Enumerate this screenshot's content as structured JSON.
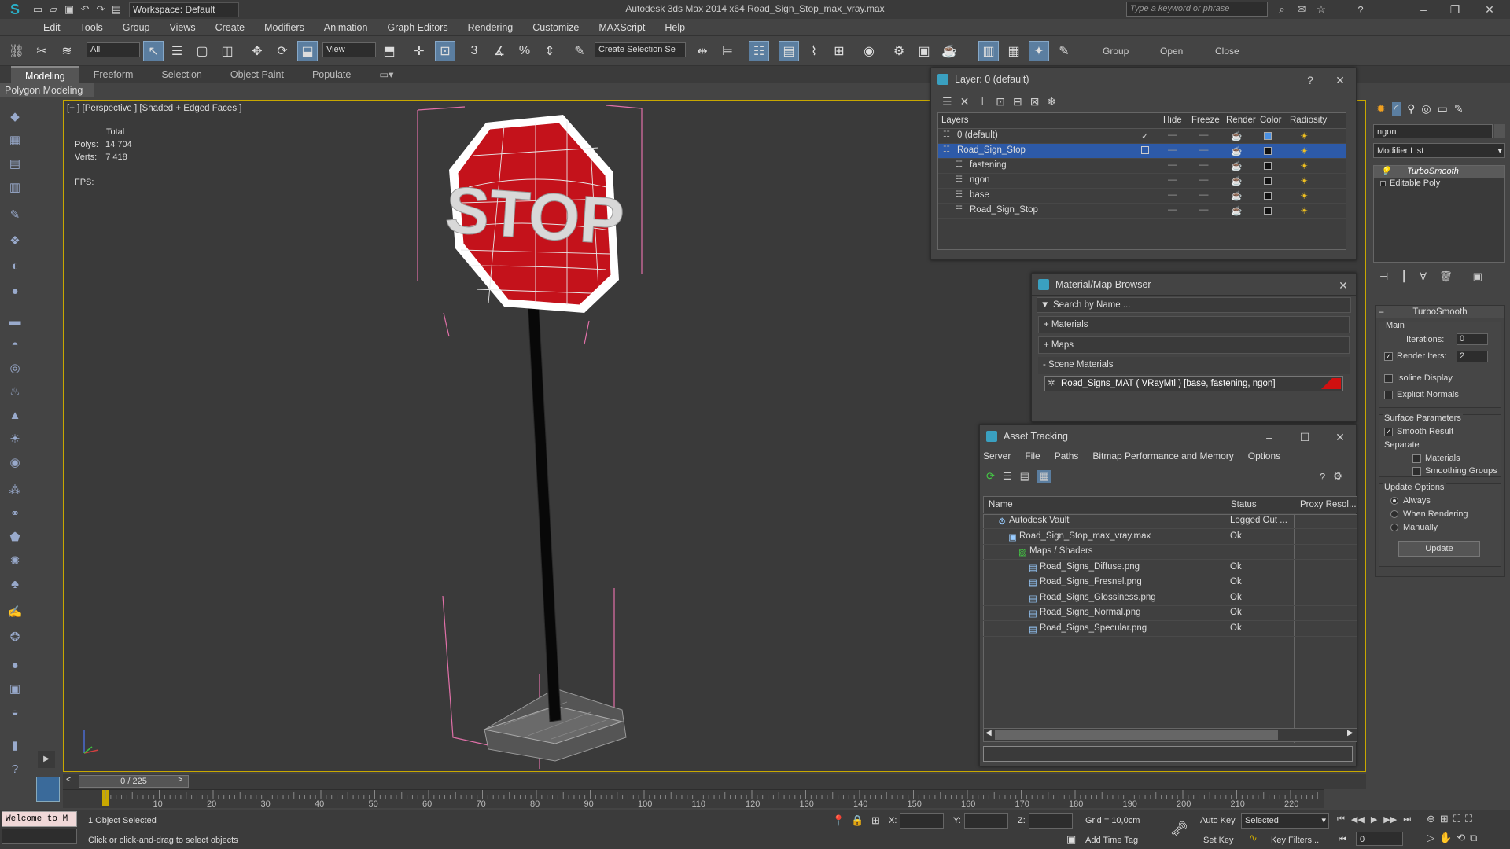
{
  "app": {
    "window_title": "Autodesk 3ds Max  2014 x64      Road_Sign_Stop_max_vray.max",
    "workspace": "Workspace: Default",
    "search_placeholder": "Type a keyword or phrase"
  },
  "menu": [
    "Edit",
    "Tools",
    "Group",
    "Views",
    "Create",
    "Modifiers",
    "Animation",
    "Graph Editors",
    "Rendering",
    "Customize",
    "MAXScript",
    "Help"
  ],
  "toolbar": {
    "selection_filter": "All",
    "ref_coord": "View",
    "named_selection": "Create Selection Se",
    "group_label": "Group",
    "open_label": "Open",
    "close_label": "Close",
    "snap_3": "3",
    "snap_percent": "%"
  },
  "ribbon": {
    "tabs": [
      "Modeling",
      "Freeform",
      "Selection",
      "Object Paint",
      "Populate"
    ],
    "sub": "Polygon Modeling"
  },
  "viewport": {
    "label": "[+ ] [Perspective ] [Shaded + Edged Faces ]",
    "stats_total": "Total",
    "polys_label": "Polys:",
    "polys_value": "14 704",
    "verts_label": "Verts:",
    "verts_value": "7 418",
    "fps_label": "FPS:",
    "sign_text": "STOP",
    "accent": "#c8a800"
  },
  "layer_panel": {
    "title": "Layer: 0 (default)",
    "help": "?",
    "headers": [
      "Layers",
      "Hide",
      "Freeze",
      "Render",
      "Color",
      "Radiosity"
    ],
    "rows": [
      {
        "name": "0 (default)",
        "color": "#4a90e2",
        "selected": false,
        "indent": 0
      },
      {
        "name": "Road_Sign_Stop",
        "color": "#111111",
        "selected": true,
        "indent": 0
      },
      {
        "name": "fastening",
        "color": "#111111",
        "selected": false,
        "indent": 1
      },
      {
        "name": "ngon",
        "color": "#111111",
        "selected": false,
        "indent": 1
      },
      {
        "name": "base",
        "color": "#111111",
        "selected": false,
        "indent": 1
      },
      {
        "name": "Road_Sign_Stop",
        "color": "#111111",
        "selected": false,
        "indent": 1
      }
    ]
  },
  "material_browser": {
    "title": "Material/Map Browser",
    "search": "Search by Name ...",
    "sections": [
      "+ Materials",
      "+ Maps",
      "- Scene Materials"
    ],
    "scene_material": "Road_Signs_MAT  ( VRayMtl )  [base, fastening, ngon]"
  },
  "asset_tracking": {
    "title": "Asset Tracking",
    "menu": [
      "Server",
      "File",
      "Paths",
      "Bitmap Performance and Memory",
      "Options"
    ],
    "headers": [
      "Name",
      "Status",
      "Proxy Resol..."
    ],
    "rows": [
      {
        "name": "Autodesk Vault",
        "status": "Logged Out ...",
        "indent": 1
      },
      {
        "name": "Road_Sign_Stop_max_vray.max",
        "status": "Ok",
        "indent": 2
      },
      {
        "name": "Maps / Shaders",
        "status": "",
        "indent": 3
      },
      {
        "name": "Road_Signs_Diffuse.png",
        "status": "Ok",
        "indent": 4
      },
      {
        "name": "Road_Signs_Fresnel.png",
        "status": "Ok",
        "indent": 4
      },
      {
        "name": "Road_Signs_Glossiness.png",
        "status": "Ok",
        "indent": 4
      },
      {
        "name": "Road_Signs_Normal.png",
        "status": "Ok",
        "indent": 4
      },
      {
        "name": "Road_Signs_Specular.png",
        "status": "Ok",
        "indent": 4
      }
    ]
  },
  "command_panel": {
    "object_name": "ngon",
    "modifier_list": "Modifier List",
    "stack": [
      "TurboSmooth",
      "Editable Poly"
    ],
    "rollout_title": "TurboSmooth",
    "main_label": "Main",
    "iterations_label": "Iterations:",
    "iterations_value": "0",
    "render_iters_label": "Render Iters:",
    "render_iters_value": "2",
    "isoline": "Isoline Display",
    "explicit_normals": "Explicit Normals",
    "surface_params": "Surface Parameters",
    "smooth_result": "Smooth Result",
    "separate": "Separate",
    "materials": "Materials",
    "smoothing_groups": "Smoothing Groups",
    "update_options": "Update Options",
    "always": "Always",
    "when_rendering": "When Rendering",
    "manually": "Manually",
    "update_button": "Update"
  },
  "timeline": {
    "frame": "0 / 225",
    "ticks": [
      "10",
      "20",
      "30",
      "40",
      "50",
      "60",
      "70",
      "80",
      "90",
      "100",
      "110",
      "120",
      "130",
      "140",
      "150",
      "160",
      "170",
      "180",
      "190",
      "200",
      "210",
      "220"
    ]
  },
  "status": {
    "maxscript": "Welcome to M",
    "selected": "1 Object Selected",
    "prompt": "Click or click-and-drag to select objects",
    "x_label": "X:",
    "y_label": "Y:",
    "z_label": "Z:",
    "grid": "Grid = 10,0cm",
    "add_time_tag": "Add Time Tag",
    "auto_key": "Auto Key",
    "set_key": "Set Key",
    "key_mode": "Selected",
    "key_filters": "Key Filters...",
    "frame_field": "0"
  }
}
